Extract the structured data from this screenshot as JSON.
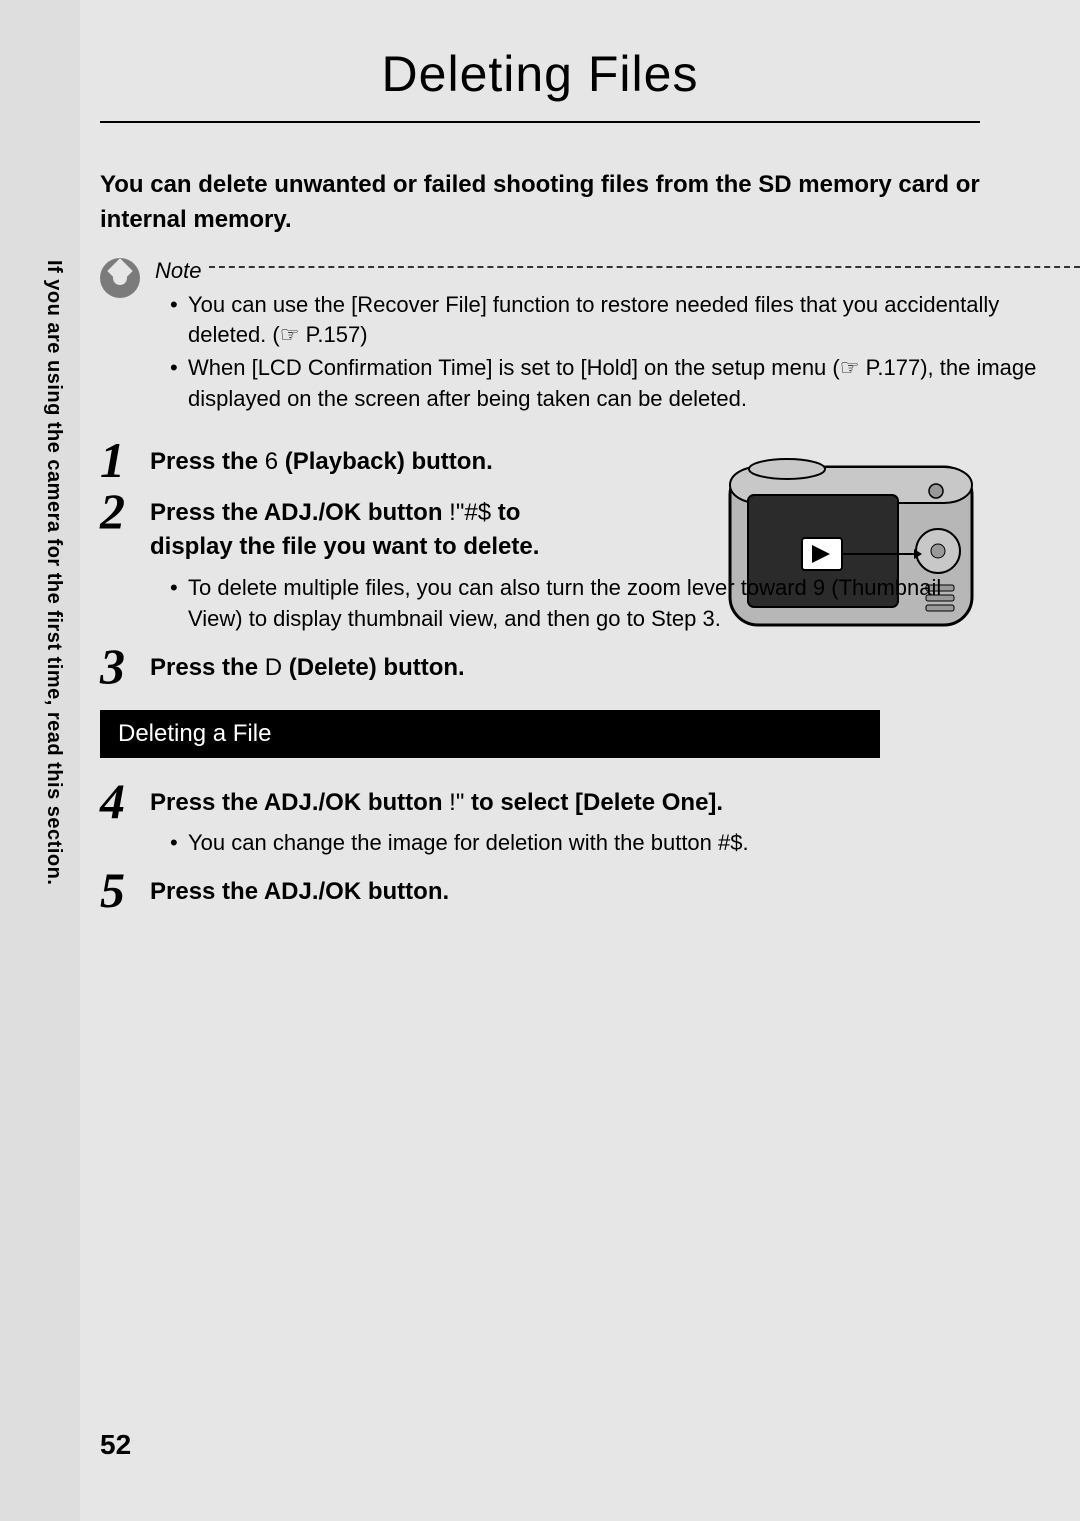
{
  "title": "Deleting Files",
  "intro": "You can delete unwanted or failed shooting files from the SD memory card or internal memory.",
  "note": {
    "label": "Note",
    "items": [
      "You can use the [Recover File] function to restore needed files that you accidentally deleted. (☞ P.157)",
      "When [LCD Confirmation Time] is set to [Hold] on the setup menu (☞ P.177), the image displayed on the screen after being taken can be deleted."
    ]
  },
  "steps": {
    "s1_a": "Press the ",
    "s1_b": "6",
    "s1_c": " (Playback) button.",
    "s2_a": "Press the ADJ./OK button ",
    "s2_b": "!\"#$",
    "s2_c": " to display the file you want to delete.",
    "s2_sub_a": "To delete multiple files, you can also turn the zoom lever toward ",
    "s2_sub_b": "9",
    "s2_sub_c": " (Thumbnail View) to display thumbnail view, and then go to Step 3.",
    "s3_a": "Press the ",
    "s3_b": "D",
    "s3_c": " (Delete) button.",
    "section": "Deleting a File",
    "s4_a": "Press the ADJ./OK button ",
    "s4_b": "!\"",
    "s4_c": " to select [Delete One].",
    "s4_sub_a": "You can change the image for deletion with the button ",
    "s4_sub_b": "#$",
    "s4_sub_c": ".",
    "s5": "Press the ADJ./OK button."
  },
  "side_text": "If you are using the camera for the first time, read this section.",
  "page_number": "52"
}
